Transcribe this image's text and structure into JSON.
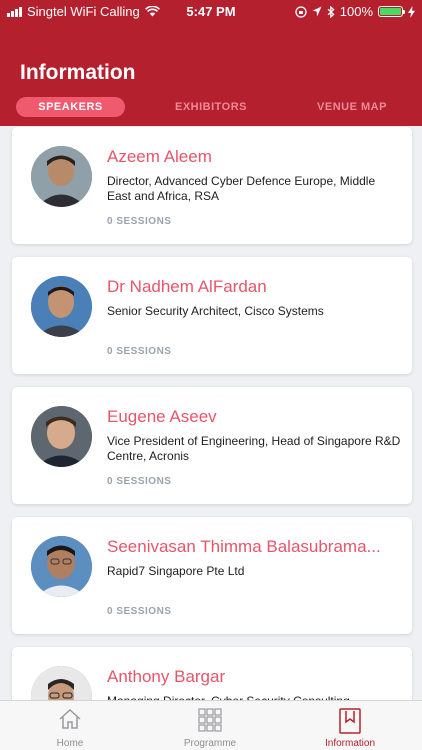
{
  "status_bar": {
    "carrier": "Singtel WiFi Calling",
    "time": "5:47 PM",
    "battery": "100%"
  },
  "header": {
    "title": "Information"
  },
  "tabs": [
    {
      "label": "SPEAKERS",
      "active": true
    },
    {
      "label": "EXHIBITORS",
      "active": false
    },
    {
      "label": "VENUE MAP",
      "active": false
    }
  ],
  "speakers": [
    {
      "name": "Azeem Aleem",
      "role": "Director, Advanced Cyber Defence Europe, Middle East and Africa, RSA",
      "sessions": "0 SESSIONS"
    },
    {
      "name": "Dr Nadhem AlFardan",
      "role": "Senior Security Architect, Cisco Systems",
      "sessions": "0 SESSIONS"
    },
    {
      "name": "Eugene Aseev",
      "role": "Vice President of Engineering, Head of Singapore R&D Centre, Acronis",
      "sessions": "0 SESSIONS"
    },
    {
      "name": "Seenivasan Thimma Balasubrama...",
      "role": "Rapid7 Singapore Pte Ltd",
      "sessions": "0 SESSIONS"
    },
    {
      "name": "Anthony Bargar",
      "role": "Managing Director, Cyber Security Consulting",
      "sessions": ""
    }
  ],
  "bottom_tabs": [
    {
      "label": "Home",
      "icon": "home-icon",
      "active": false
    },
    {
      "label": "Programme",
      "icon": "grid-icon",
      "active": false
    },
    {
      "label": "Information",
      "icon": "bookmark-icon",
      "active": true
    }
  ],
  "colors": {
    "header": "#b5202f",
    "accent": "#e6566a",
    "active_tab_pill": "#f05a6e"
  }
}
